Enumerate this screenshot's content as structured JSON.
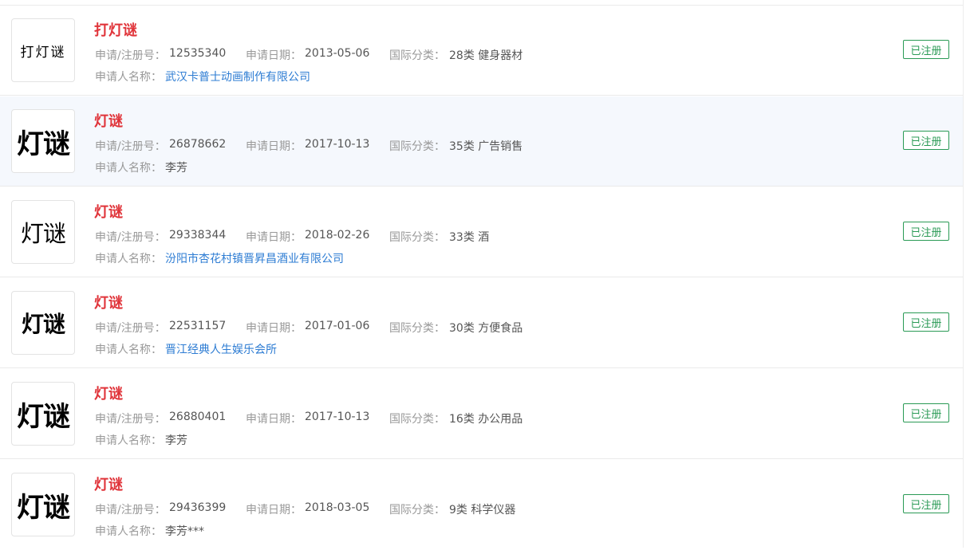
{
  "labels": {
    "reg_no": "申请/注册号：",
    "date": "申请日期：",
    "class": "国际分类：",
    "applicant": "申请人名称："
  },
  "items": [
    {
      "name": "打灯谜",
      "logo_text": "打灯谜",
      "reg_no": "12535340",
      "date": "2013-05-06",
      "class": "28类 健身器材",
      "applicant": "武汉卡普士动画制作有限公司",
      "status": "已注册"
    },
    {
      "name": "灯谜",
      "logo_text": "灯谜",
      "reg_no": "26878662",
      "date": "2017-10-13",
      "class": "35类 广告销售",
      "applicant": "李芳",
      "status": "已注册"
    },
    {
      "name": "灯谜",
      "logo_text": "灯谜",
      "reg_no": "29338344",
      "date": "2018-02-26",
      "class": "33类 酒",
      "applicant": "汾阳市杏花村镇晋昇昌酒业有限公司",
      "status": "已注册"
    },
    {
      "name": "灯谜",
      "logo_text": "灯谜",
      "reg_no": "22531157",
      "date": "2017-01-06",
      "class": "30类 方便食品",
      "applicant": "晋江经典人生娱乐会所",
      "status": "已注册"
    },
    {
      "name": "灯谜",
      "logo_text": "灯谜",
      "reg_no": "26880401",
      "date": "2017-10-13",
      "class": "16类 办公用品",
      "applicant": "李芳",
      "status": "已注册"
    },
    {
      "name": "灯谜",
      "logo_text": "灯谜",
      "reg_no": "29436399",
      "date": "2018-03-05",
      "class": "9类 科学仪器",
      "applicant": "李芳***",
      "status": "已注册"
    }
  ]
}
